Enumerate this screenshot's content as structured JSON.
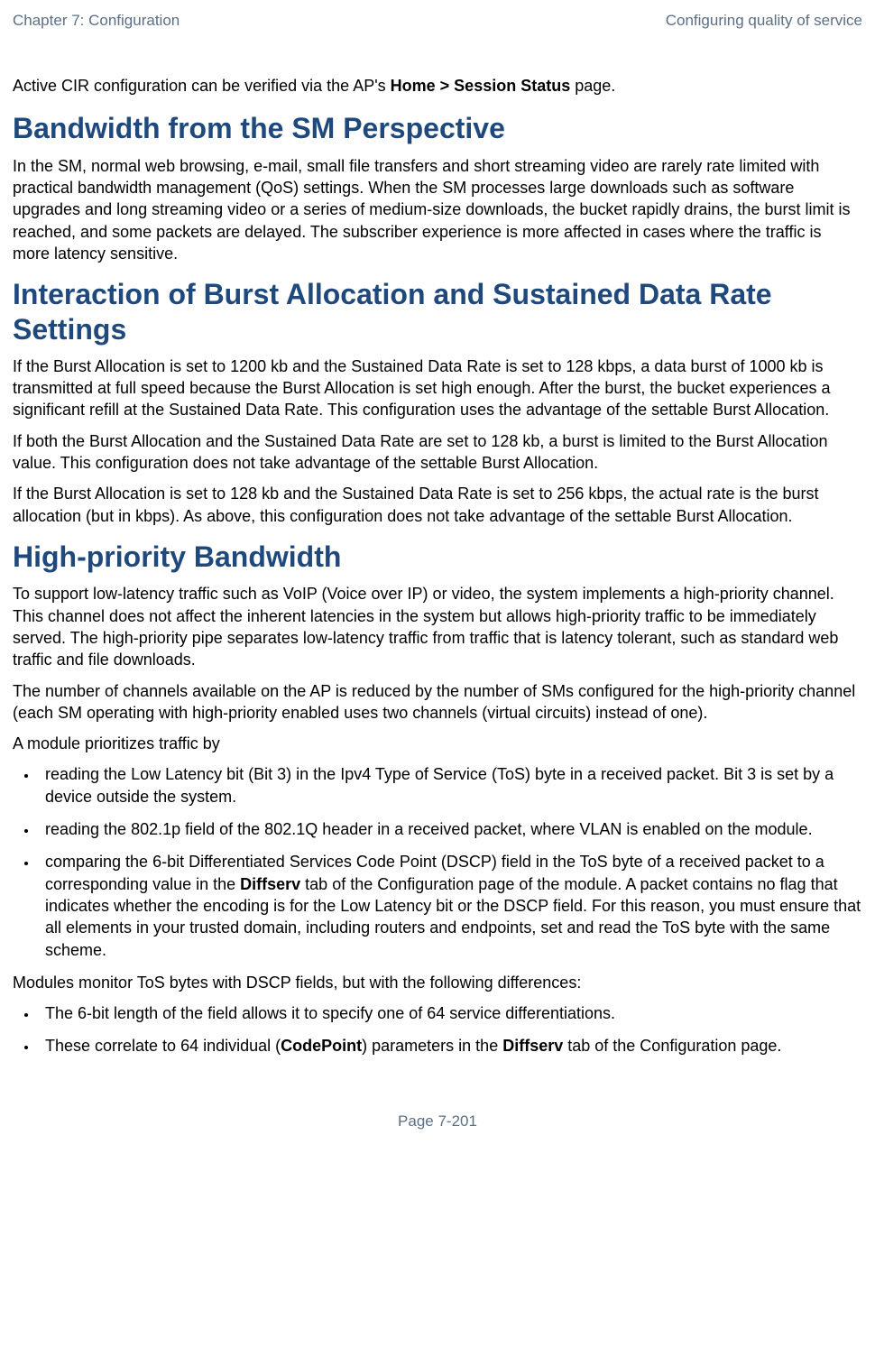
{
  "header": {
    "left": "Chapter 7:  Configuration",
    "right": "Configuring quality of service"
  },
  "intro": {
    "pre": "Active CIR configuration can be verified via the AP's ",
    "bold": "Home > Session Status",
    "post": " page."
  },
  "h1": "Bandwidth from the SM Perspective",
  "p1": "In the SM, normal web browsing, e-mail, small file transfers and short streaming video are rarely rate limited with practical bandwidth management (QoS) settings. When the SM processes large downloads such as software upgrades and long streaming video or a series of medium-size downloads, the bucket rapidly drains, the burst limit is reached, and some packets are delayed. The subscriber experience is more affected in cases where the traffic is more latency sensitive.",
  "h2": "Interaction of Burst Allocation and Sustained Data Rate Settings",
  "p2a": "If the Burst Allocation is set to 1200 kb and the Sustained Data Rate is set to 128 kbps, a data burst of 1000 kb is transmitted at full speed because the Burst Allocation is set high enough. After the burst, the bucket experiences a significant refill at the Sustained Data Rate. This configuration uses the advantage of the settable Burst Allocation.",
  "p2b": "If both the Burst Allocation and the Sustained Data Rate are set to 128 kb, a burst is limited to the Burst Allocation value. This configuration does not take advantage of the settable Burst Allocation.",
  "p2c": "If the Burst Allocation is set to 128 kb and the Sustained Data Rate is set to 256 kbps, the actual rate is the burst allocation (but in kbps). As above, this configuration does not take advantage of the settable Burst Allocation.",
  "h3": "High-priority Bandwidth",
  "p3a": "To support low-latency traffic such as VoIP (Voice over IP) or video, the system implements a high-priority channel. This channel does not affect the inherent latencies in the system but allows high-priority traffic to be immediately served. The high-priority pipe separates low-latency traffic from traffic that is latency tolerant, such as standard web traffic and file downloads.",
  "p3b": "The number of channels available on the AP is reduced by the number of SMs configured for the high-priority channel (each SM operating with high-priority enabled uses two channels (virtual circuits) instead of one).",
  "p3c": "A module prioritizes traffic by",
  "list1": {
    "i0": "reading the Low Latency bit (Bit 3) in the Ipv4 Type of Service (ToS) byte in a received packet. Bit 3 is set by a device outside the system.",
    "i1": "reading the 802.1p field of the 802.1Q header in a received packet, where VLAN is enabled on the module.",
    "i2_pre": "comparing the 6-bit Differentiated Services Code Point (DSCP) field in the ToS byte of a received packet to a corresponding value in the ",
    "i2_bold": "Diffserv",
    "i2_post": " tab of the Configuration page of the module. A packet contains no flag that indicates whether the encoding is for the Low Latency bit or the DSCP field. For this reason, you must ensure that all elements in your trusted domain, including routers and endpoints, set and read the ToS byte with the same scheme."
  },
  "p3d": "Modules monitor ToS bytes with DSCP fields, but with the following differences:",
  "list2": {
    "i0": "The 6-bit length of the field allows it to specify one of 64 service differentiations.",
    "i1_pre": "These correlate to 64 individual (",
    "i1_bold1": "CodePoint",
    "i1_mid": ") parameters in the ",
    "i1_bold2": "Diffserv",
    "i1_post": " tab of the Configuration page."
  },
  "footer": "Page 7-201"
}
